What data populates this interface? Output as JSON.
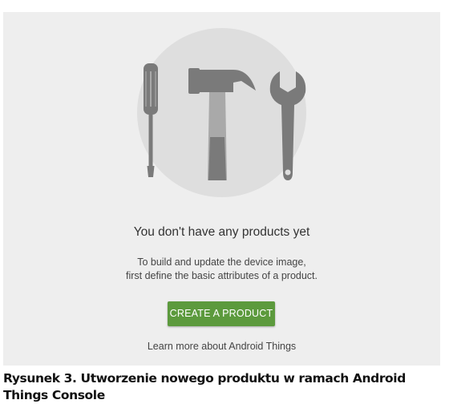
{
  "empty_state": {
    "illustration_icons": [
      "screwdriver-icon",
      "hammer-icon",
      "wrench-icon"
    ],
    "title": "You don't have any products yet",
    "description_line1": "To build and update the device image,",
    "description_line2": "first define the basic attributes of a product.",
    "create_button_label": "CREATE A PRODUCT",
    "learn_more_link": "Learn more about Android Things"
  },
  "caption": {
    "line1": "Rysunek 3. Utworzenie nowego produktu w ramach Android",
    "line2": "Things Console"
  },
  "colors": {
    "panel_background": "#eeeeee",
    "illustration_circle": "#dedede",
    "tool_dark": "#7a7a7a",
    "tool_light": "#a9a9a9",
    "button_green": "#5c9a3d",
    "button_text": "#ffffff"
  }
}
